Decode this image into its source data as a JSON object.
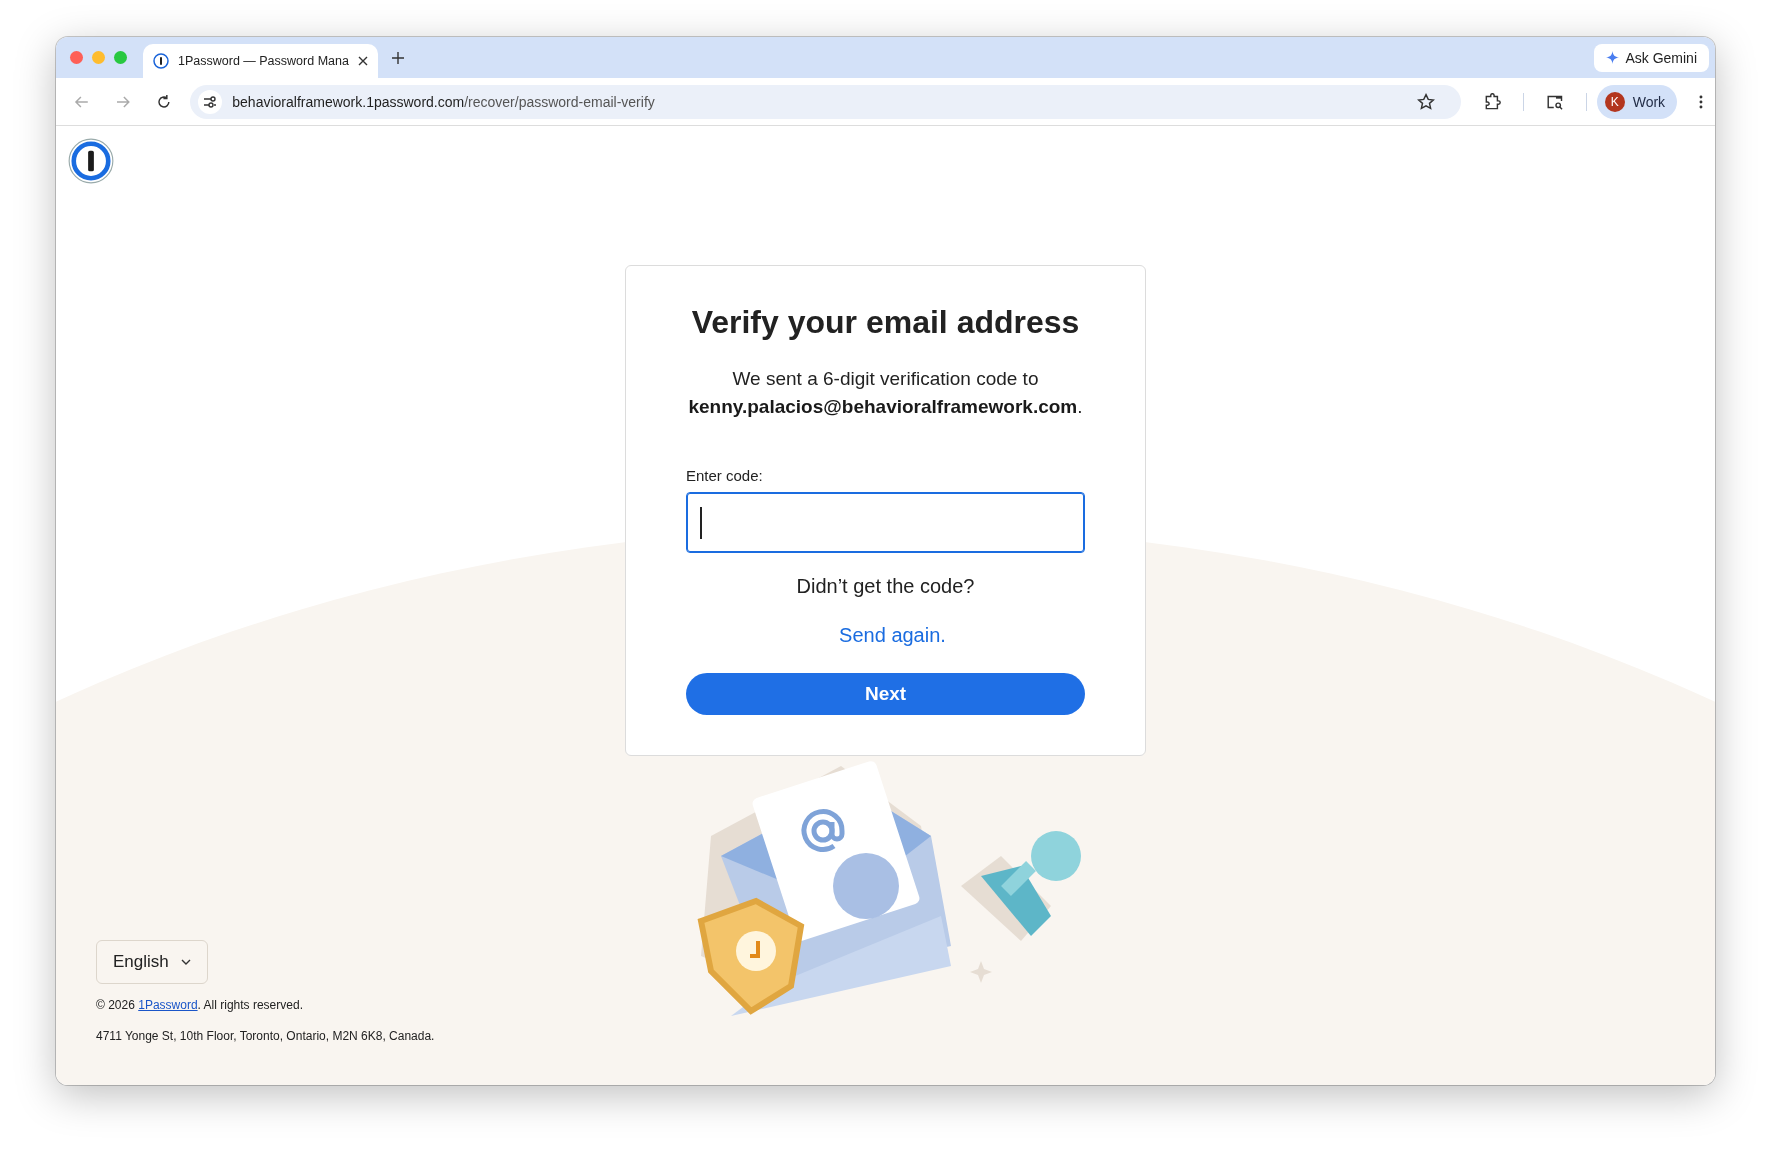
{
  "browser": {
    "tab": {
      "title": "1Password — Password Mana",
      "selected": true
    },
    "ask_button": "Ask Gemini",
    "address": {
      "host": "behavioralframework.1password.com",
      "path": "/recover/password-email-verify"
    },
    "profile": {
      "initial": "K",
      "name": "Work"
    }
  },
  "card": {
    "title": "Verify your email address",
    "message": "We sent a 6-digit verification code to **kenny.palacios@behavioralframework.com**.",
    "code_field": {
      "label": "Enter code:",
      "focused": true
    },
    "resend_prompt": "Didn’t get the code?",
    "resend_link": "Send again.",
    "next_button": "Next"
  },
  "footer": {
    "language": "English",
    "copyright_prefix": "© 2026 ",
    "copyright_link": "1Password",
    "copyright_suffix": ". All rights reserved.",
    "address": "4711 Yonge St, 10th Floor, Toronto, Ontario, M2N 6K8, Canada."
  }
}
